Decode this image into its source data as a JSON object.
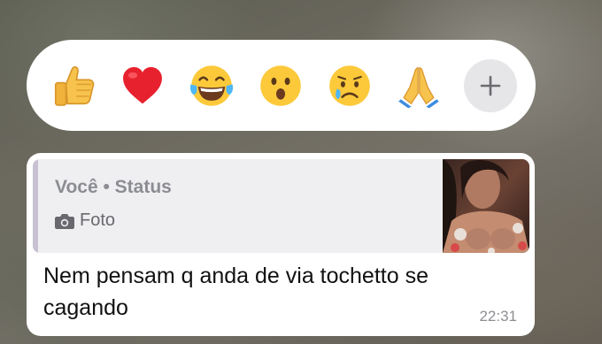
{
  "reactions": [
    {
      "name": "thumbs-up",
      "emoji": "👍"
    },
    {
      "name": "red-heart",
      "emoji": "❤️"
    },
    {
      "name": "tears-of-joy",
      "emoji": "😂"
    },
    {
      "name": "surprised",
      "emoji": "😮"
    },
    {
      "name": "crying",
      "emoji": "😢"
    },
    {
      "name": "folded-hands",
      "emoji": "🙏"
    }
  ],
  "more_reactions_icon": "plus-icon",
  "message": {
    "quote": {
      "author": "Você • Status",
      "media_icon": "camera-icon",
      "media_label": "Foto"
    },
    "text": "Nem pensam q anda de via tochetto se cagando",
    "time": "22:31"
  },
  "colors": {
    "bubble": "#ffffff",
    "quote_background": "#efeff1",
    "quote_accent": "#c7c1d3",
    "plus_button": "#e6e6e8"
  }
}
